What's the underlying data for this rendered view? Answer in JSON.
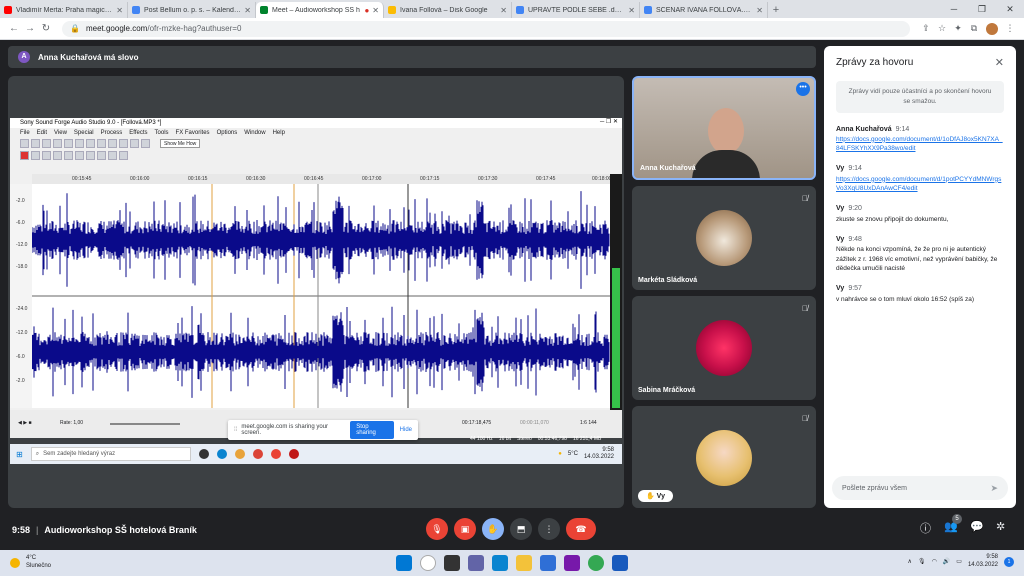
{
  "tabs": [
    {
      "title": "Vladimír Merta: Praha magická (",
      "color": "#ff0000"
    },
    {
      "title": "Post Bellum o. p. s. – Kalendář - ",
      "color": "#4285f4"
    },
    {
      "title": "Meet – Audioworkshop SŠ h",
      "color": "#00832d"
    },
    {
      "title": "Ivana Follová – Disk Google",
      "color": "#fbbc04"
    },
    {
      "title": "UPRAVTE PODLE SEBE .docx - D",
      "color": "#4285f4"
    },
    {
      "title": "SCÉNÁŘ IVANA FOLLOVÁ.docx - ",
      "color": "#4285f4"
    }
  ],
  "address": {
    "host": "meet.google.com",
    "path": "/ofr-mzke-hag?authuser=0"
  },
  "speaker": {
    "initial": "A",
    "text": "Anna Kuchařová má slovo"
  },
  "app": {
    "title": "Sony Sound Forge Audio Studio 9.0 - [Follová.MP3 *]",
    "menu": [
      "File",
      "Edit",
      "View",
      "Special",
      "Process",
      "Effects",
      "Tools",
      "FX Favorites",
      "Options",
      "Window",
      "Help"
    ],
    "show_me": "Show Me How",
    "ruler": [
      "00:15:45",
      "00:16:00",
      "00:16:15",
      "00:16:30",
      "00:16:45",
      "00:17:00",
      "00:17:15",
      "00:17:30",
      "00:17:45",
      "00:18:00"
    ],
    "db_labels": [
      "-2.0",
      "-6.0",
      "-12.0",
      "-18.0",
      "-24.0",
      "-12.0",
      "-6.0",
      "-2.0"
    ],
    "rate": "Rate: 1,00",
    "status": [
      "00:17:18,475",
      "00:00:11,070",
      "1:6 144"
    ],
    "status2": [
      "44 100 Hz",
      "16 bit",
      "Stereo",
      "00:53:46,798",
      "16 251,4 MB"
    ]
  },
  "share": {
    "text": "meet.google.com is sharing your screen.",
    "stop": "Stop sharing",
    "hide": "Hide"
  },
  "inner_taskbar": {
    "search": "Sem zadejte hledaný výraz",
    "temp": "5°C",
    "time": "9:58",
    "date": "14.03.2022"
  },
  "participants": [
    {
      "name": "Anna Kuchařová"
    },
    {
      "name": "Markéta Sládková"
    },
    {
      "name": "Sabina Mráčková"
    },
    {
      "name": "Vy"
    }
  ],
  "chat": {
    "title": "Zprávy za hovoru",
    "note": "Zprávy vidí pouze účastníci a po skončení hovoru se smažou.",
    "messages": [
      {
        "who": "Anna Kuchařová",
        "time": "9:14",
        "link": "https://docs.google.com/document/d/1oDfAJ8ox5KN7XA_84LFSKYhXX9Pa38wo/edit",
        "text": ""
      },
      {
        "who": "Vy",
        "time": "9:14",
        "link": "https://docs.google.com/document/d/1potPCYYdMNWrgsVo3XqU8UxDAnAwCF4/edit",
        "text": ""
      },
      {
        "who": "Vy",
        "time": "9:20",
        "link": "",
        "text": "zkuste se znovu připojit do dokumentu,"
      },
      {
        "who": "Vy",
        "time": "9:48",
        "link": "",
        "text": "Někde na konci vzpomíná, že že pro ni je autentický zážitek z r. 1968 víc emotivní, než vyprávění babičky, že dědečka umučili nacisté"
      },
      {
        "who": "Vy",
        "time": "9:57",
        "link": "",
        "text": "v nahrávce se o tom mluví okolo 16:52 (spíš za)"
      }
    ],
    "placeholder": "Pošlete zprávu všem"
  },
  "meeting": {
    "time": "9:58",
    "name": "Audioworkshop SŠ hotelová Braník",
    "participants_badge": "5"
  },
  "os": {
    "temp": "4°C",
    "weather": "Slunečno",
    "time": "9:58",
    "date": "14.03.2022",
    "notif": "1"
  }
}
